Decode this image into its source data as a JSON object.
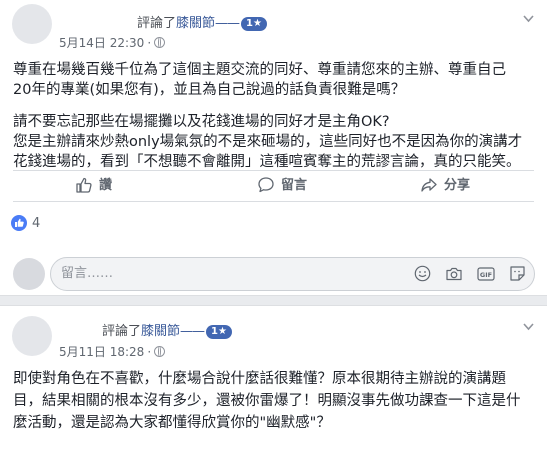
{
  "post1": {
    "action": "評論了",
    "page_name": "膝關節",
    "badge": "1★",
    "date": "5月14日 22:30",
    "separator": "·",
    "text_lines": [
      "尊重在場幾百幾千位為了這個主題交流的同好、尊重請您來的主辦、尊重自己",
      "20年的專業(如果您有)，並且為自己說過的話負責很難是嗎？",
      "請不要忘記那些在場擺攤以及花錢進場的同好才是主角OK?",
      "您是主辦請來炒熱only場氣氛的不是來砸場的，這些同好也不是因為你的演講才",
      "花錢進場的，看到「不想聽不會離開」這種喧賓奪主的荒謬言論，真的只能笑。"
    ],
    "like_label": "讚",
    "comment_label": "留言",
    "share_label": "分享",
    "reaction_count": "4",
    "comment_placeholder": "留言……"
  },
  "post2": {
    "action": "評論了",
    "page_name": "膝關節",
    "badge": "1★",
    "date": "5月11日 18:28",
    "separator": "·",
    "text_lines": [
      "即使對角色在不喜歡，什麼場合說什麼話很難懂？原本很期待主辦說的演講題",
      "目，結果相關的根本沒有多少，還被你雷爆了！明顯沒事先做功課查一下這是什",
      "麼活動，還是認為大家都懂得欣賞你的\"幽默感\"？"
    ]
  }
}
